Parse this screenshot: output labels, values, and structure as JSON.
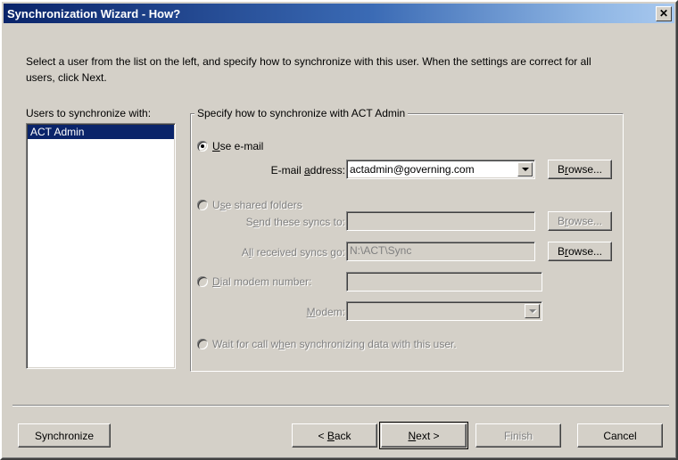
{
  "window": {
    "title": "Synchronization Wizard - How?",
    "close_label": "×",
    "close_icon": "close-icon"
  },
  "instruction": "Select a user from the list on the left, and specify how to synchronize with this user. When the settings are correct for all users, click Next.",
  "user_list": {
    "label": "Users to synchronize with:",
    "items": [
      {
        "label": "ACT Admin",
        "selected": true
      }
    ]
  },
  "group": {
    "title": "Specify how to synchronize with ACT Admin",
    "options": {
      "email": {
        "label_pre": "U",
        "label_acc": "",
        "label": "Use e-mail",
        "checked": true,
        "enabled": true
      },
      "shared_folders": {
        "label": "Use shared folders",
        "checked": false,
        "enabled": false
      },
      "dial_modem": {
        "label": "Dial modem number:",
        "checked": false,
        "enabled": false
      },
      "wait_for_call": {
        "label": "Wait for call when synchronizing data with this user.",
        "checked": false,
        "enabled": false
      }
    },
    "fields": {
      "email_address": {
        "label": "E-mail address:",
        "value": "actadmin@governing.com",
        "enabled": true,
        "browse_label": "Browse...",
        "browse_enabled": true
      },
      "send_syncs_to": {
        "label": "Send these syncs to:",
        "value": "",
        "enabled": false,
        "browse_label": "Browse...",
        "browse_enabled": false
      },
      "received_syncs_go": {
        "label": "All received syncs go:",
        "value": "N:\\ACT\\Sync",
        "enabled": false,
        "browse_label": "Browse...",
        "browse_enabled": true
      },
      "dial_number": {
        "value": "",
        "enabled": false
      },
      "modem": {
        "label": "Modem:",
        "value": "",
        "enabled": false
      }
    }
  },
  "buttons": {
    "synchronize": {
      "label": "Synchronize",
      "enabled": true
    },
    "back": {
      "label": "< Back",
      "enabled": true
    },
    "next": {
      "label": "Next >",
      "enabled": true,
      "is_default": true
    },
    "finish": {
      "label": "Finish",
      "enabled": false
    },
    "cancel": {
      "label": "Cancel",
      "enabled": true
    }
  },
  "colors": {
    "face": "#d4d0c8",
    "title_start": "#0a246a",
    "title_end": "#a9c9ef",
    "selection": "#0a246a",
    "disabled_text": "#808080"
  }
}
